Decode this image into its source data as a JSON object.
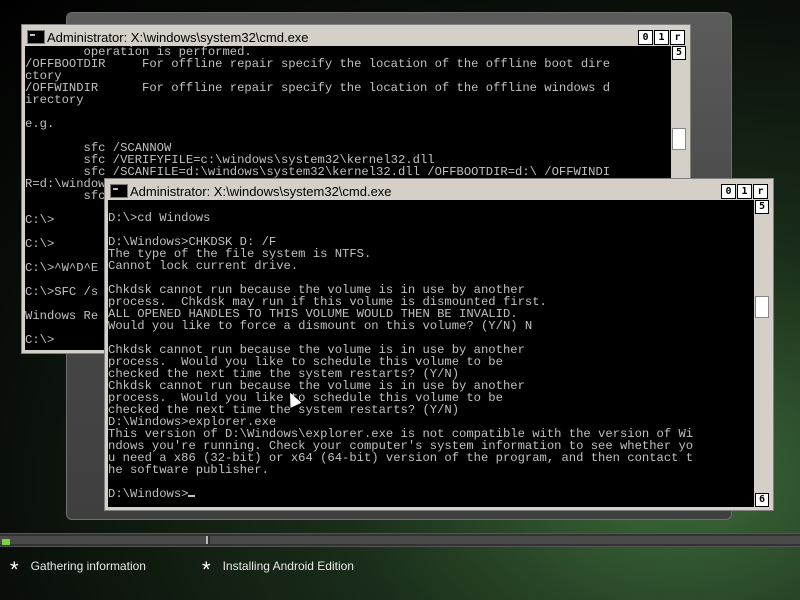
{
  "setup": {
    "steps": [
      {
        "label": "Gathering information"
      },
      {
        "label": "Installing Android Edition"
      }
    ],
    "progress_fraction": 0.01
  },
  "windows": [
    {
      "title": "Administrator: X:\\windows\\system32\\cmd.exe",
      "buttons": [
        "0",
        "1",
        "r"
      ],
      "scroll_up": "5",
      "lines": [
        "        operation is performed.",
        "/OFFBOOTDIR     For offline repair specify the location of the offline boot dire",
        "ctory",
        "/OFFWINDIR      For offline repair specify the location of the offline windows d",
        "irectory",
        "",
        "e.g.",
        "",
        "        sfc /SCANNOW",
        "        sfc /VERIFYFILE=c:\\windows\\system32\\kernel32.dll",
        "        sfc /SCANFILE=d:\\windows\\system32\\kernel32.dll /OFFBOOTDIR=d:\\ /OFFWINDI",
        "R=d:\\windows",
        "        sfc",
        "",
        "C:\\>",
        "",
        "C:\\>",
        "",
        "C:\\>^W^D^E",
        "",
        "C:\\>SFC /s",
        "",
        "Windows Re",
        "",
        "C:\\>"
      ]
    },
    {
      "title": "Administrator: X:\\windows\\system32\\cmd.exe",
      "buttons": [
        "0",
        "1",
        "r"
      ],
      "scroll_up": "5",
      "scroll_down": "6",
      "lines": [
        "",
        "D:\\>cd Windows",
        "",
        "D:\\Windows>CHKDSK D: /F",
        "The type of the file system is NTFS.",
        "Cannot lock current drive.",
        "",
        "Chkdsk cannot run because the volume is in use by another",
        "process.  Chkdsk may run if this volume is dismounted first.",
        "ALL OPENED HANDLES TO THIS VOLUME WOULD THEN BE INVALID.",
        "Would you like to force a dismount on this volume? (Y/N) N",
        "",
        "Chkdsk cannot run because the volume is in use by another",
        "process.  Would you like to schedule this volume to be",
        "checked the next time the system restarts? (Y/N)",
        "Chkdsk cannot run because the volume is in use by another",
        "process.  Would you like to schedule this volume to be",
        "checked the next time the system restarts? (Y/N)",
        "D:\\Windows>explorer.exe",
        "This version of D:\\Windows\\explorer.exe is not compatible with the version of Wi",
        "ndows you're running. Check your computer's system information to see whether yo",
        "u need a x86 (32-bit) or x64 (64-bit) version of the program, and then contact t",
        "he software publisher.",
        "",
        "D:\\Windows>"
      ]
    }
  ]
}
